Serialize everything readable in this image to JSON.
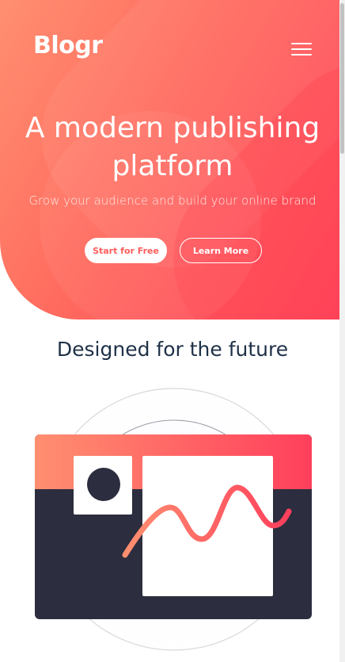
{
  "header": {
    "logo": "Blogr",
    "menu_icon": "hamburger-menu-icon"
  },
  "hero": {
    "title_line1": "A modern publishing",
    "title_line2": "platform",
    "subtitle": "Grow your audience and build your online brand",
    "start_label": "Start for Free",
    "learn_label": "Learn More"
  },
  "section": {
    "title": "Designed for the future"
  },
  "colors": {
    "brand_gradient_start": "#ff8f70",
    "brand_gradient_end": "#ff3f5c",
    "heading": "#1f3148",
    "dark_panel": "#2c2d3e"
  }
}
